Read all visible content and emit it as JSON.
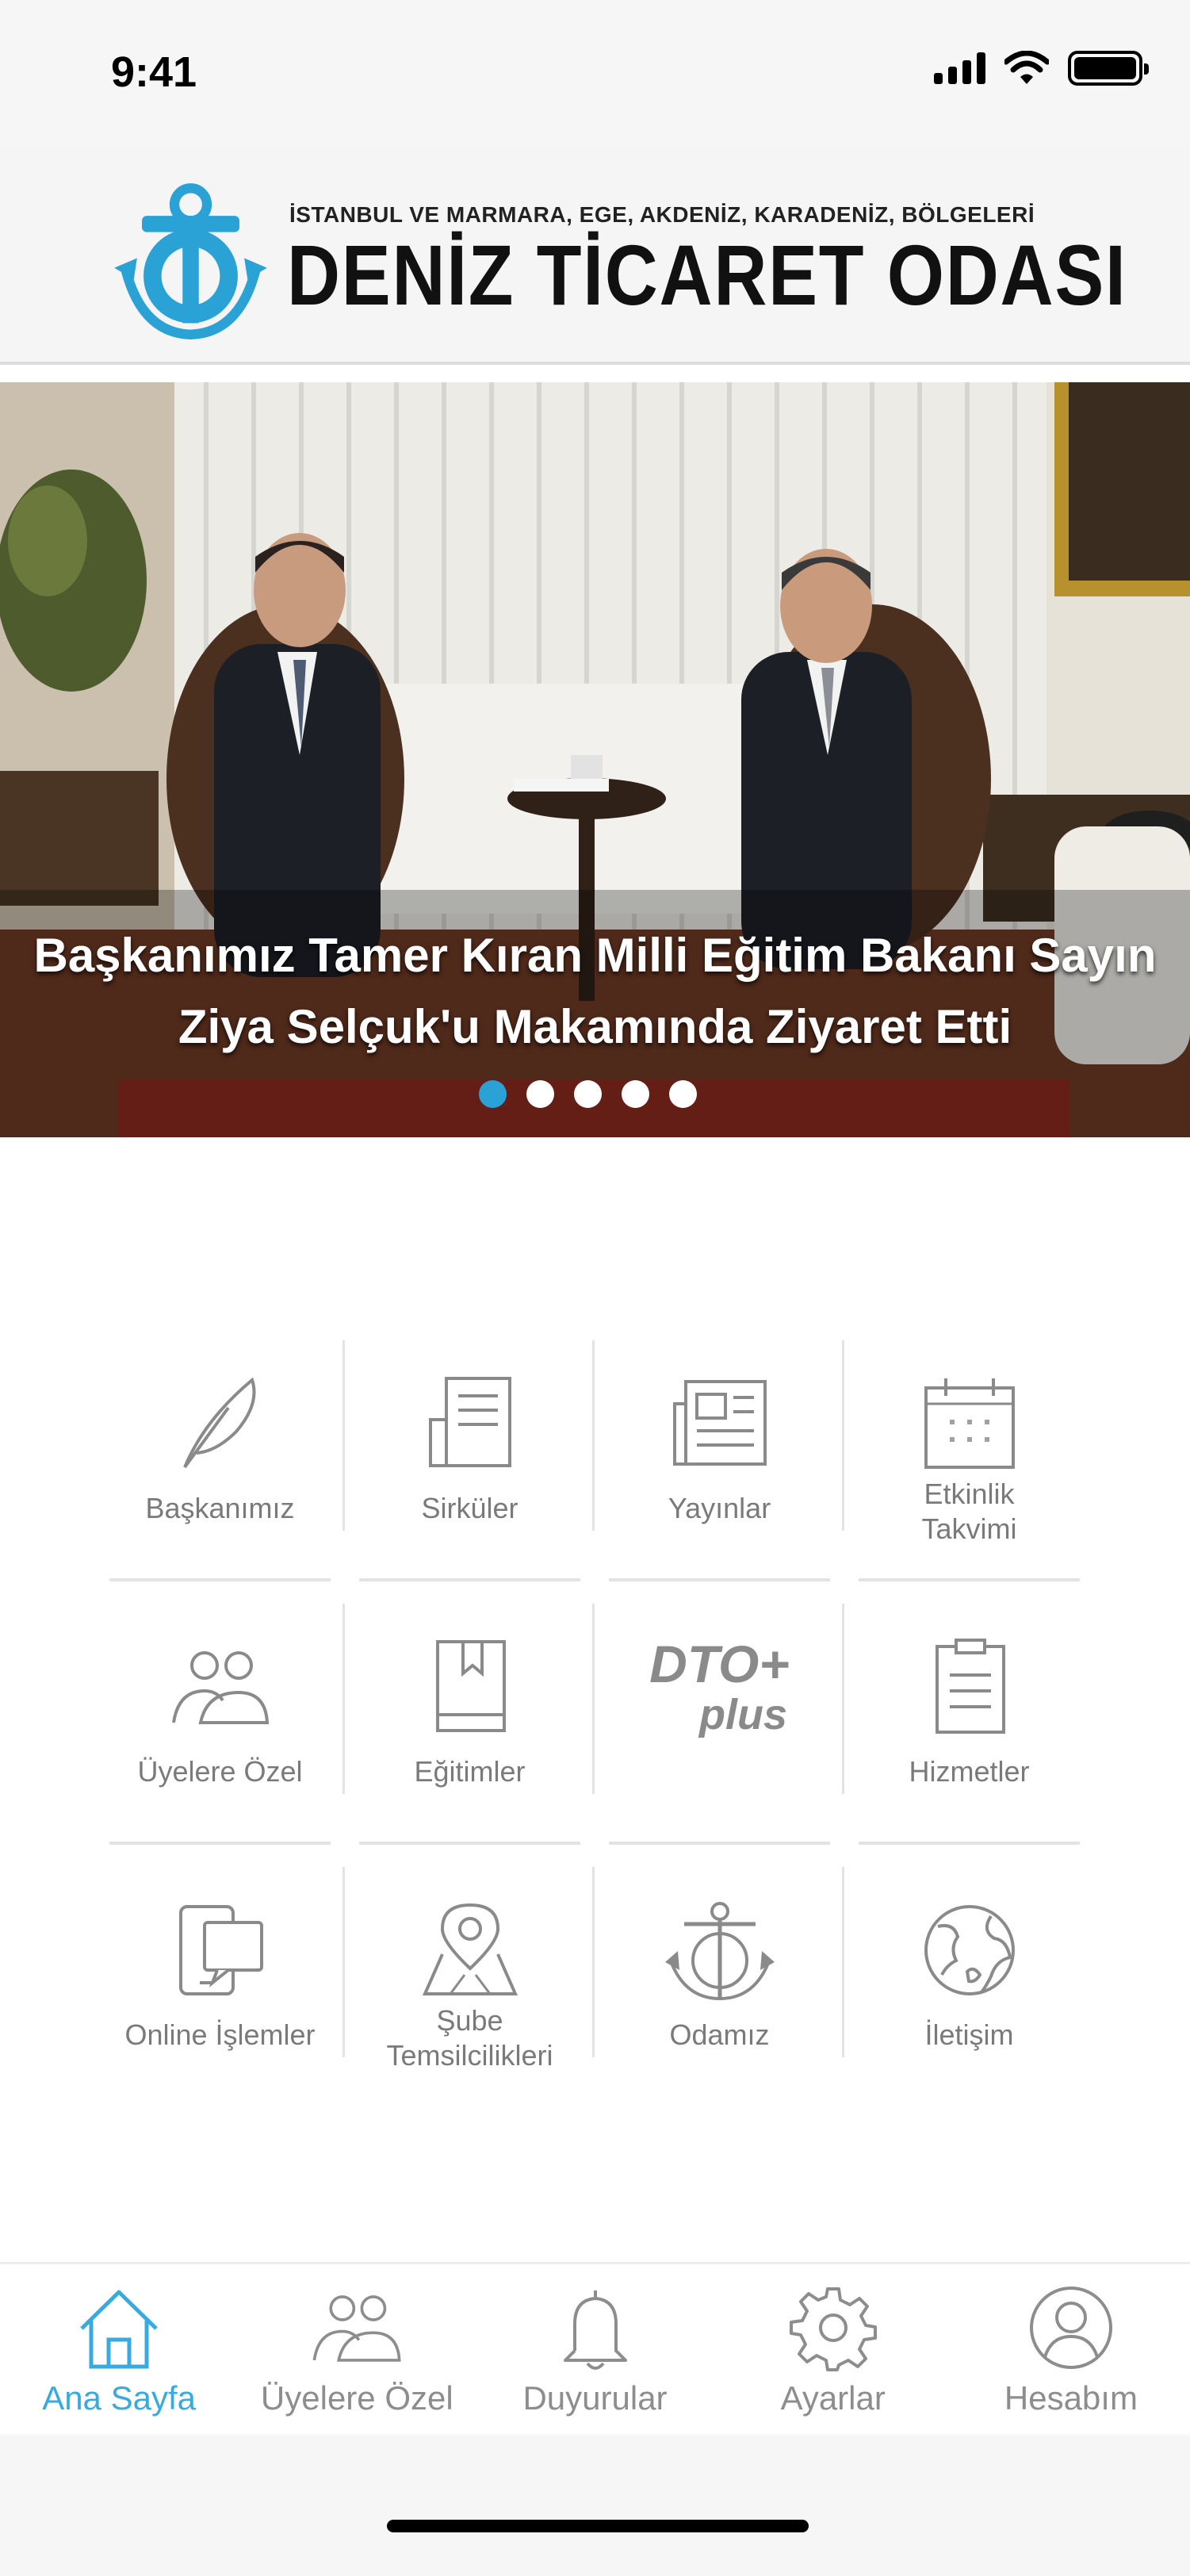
{
  "status_bar": {
    "time": "9:41"
  },
  "header": {
    "subtitle": "İSTANBUL VE MARMARA, EGE, AKDENİZ, KARADENİZ, BÖLGELERİ",
    "title": "DENİZ TİCARET ODASI",
    "brand_color": "#2aa2d6"
  },
  "banner": {
    "caption_line1": "Başkanımız Tamer Kıran  Milli Eğitim Bakanı Sayın",
    "caption_line2": "Ziya Selçuk'u Makamında Ziyaret Etti",
    "slide_count": 5,
    "active_slide": 1
  },
  "menu": {
    "rows": [
      [
        {
          "label": "Başkanımız",
          "icon": "quill-icon"
        },
        {
          "label": "Sirküler",
          "icon": "document-icon"
        },
        {
          "label": "Yayınlar",
          "icon": "newspaper-icon"
        },
        {
          "label": "Etkinlik\nTakvimi",
          "icon": "calendar-icon"
        }
      ],
      [
        {
          "label": "Üyelere Özel",
          "icon": "users-icon"
        },
        {
          "label": "Eğitimler",
          "icon": "book-icon"
        },
        {
          "label": "",
          "icon": "dto-plus-icon",
          "icon_text_1": "DTO+",
          "icon_text_2": "plus"
        },
        {
          "label": "Hizmetler",
          "icon": "clipboard-icon"
        }
      ],
      [
        {
          "label": "Online İşlemler",
          "icon": "devices-icon"
        },
        {
          "label": "Şube\nTemsilcilikleri",
          "icon": "map-pin-icon"
        },
        {
          "label": "Odamız",
          "icon": "anchor-icon"
        },
        {
          "label": "İletişim",
          "icon": "globe-icon"
        }
      ]
    ]
  },
  "tabbar": {
    "items": [
      {
        "label": "Ana Sayfa",
        "icon": "home-icon",
        "active": true
      },
      {
        "label": "Üyelere Özel",
        "icon": "users-icon",
        "active": false
      },
      {
        "label": "Duyurular",
        "icon": "bell-icon",
        "active": false
      },
      {
        "label": "Ayarlar",
        "icon": "gear-icon",
        "active": false
      },
      {
        "label": "Hesabım",
        "icon": "account-icon",
        "active": false
      }
    ],
    "active_color": "#39aadf",
    "inactive_color": "#8d8d8d"
  }
}
